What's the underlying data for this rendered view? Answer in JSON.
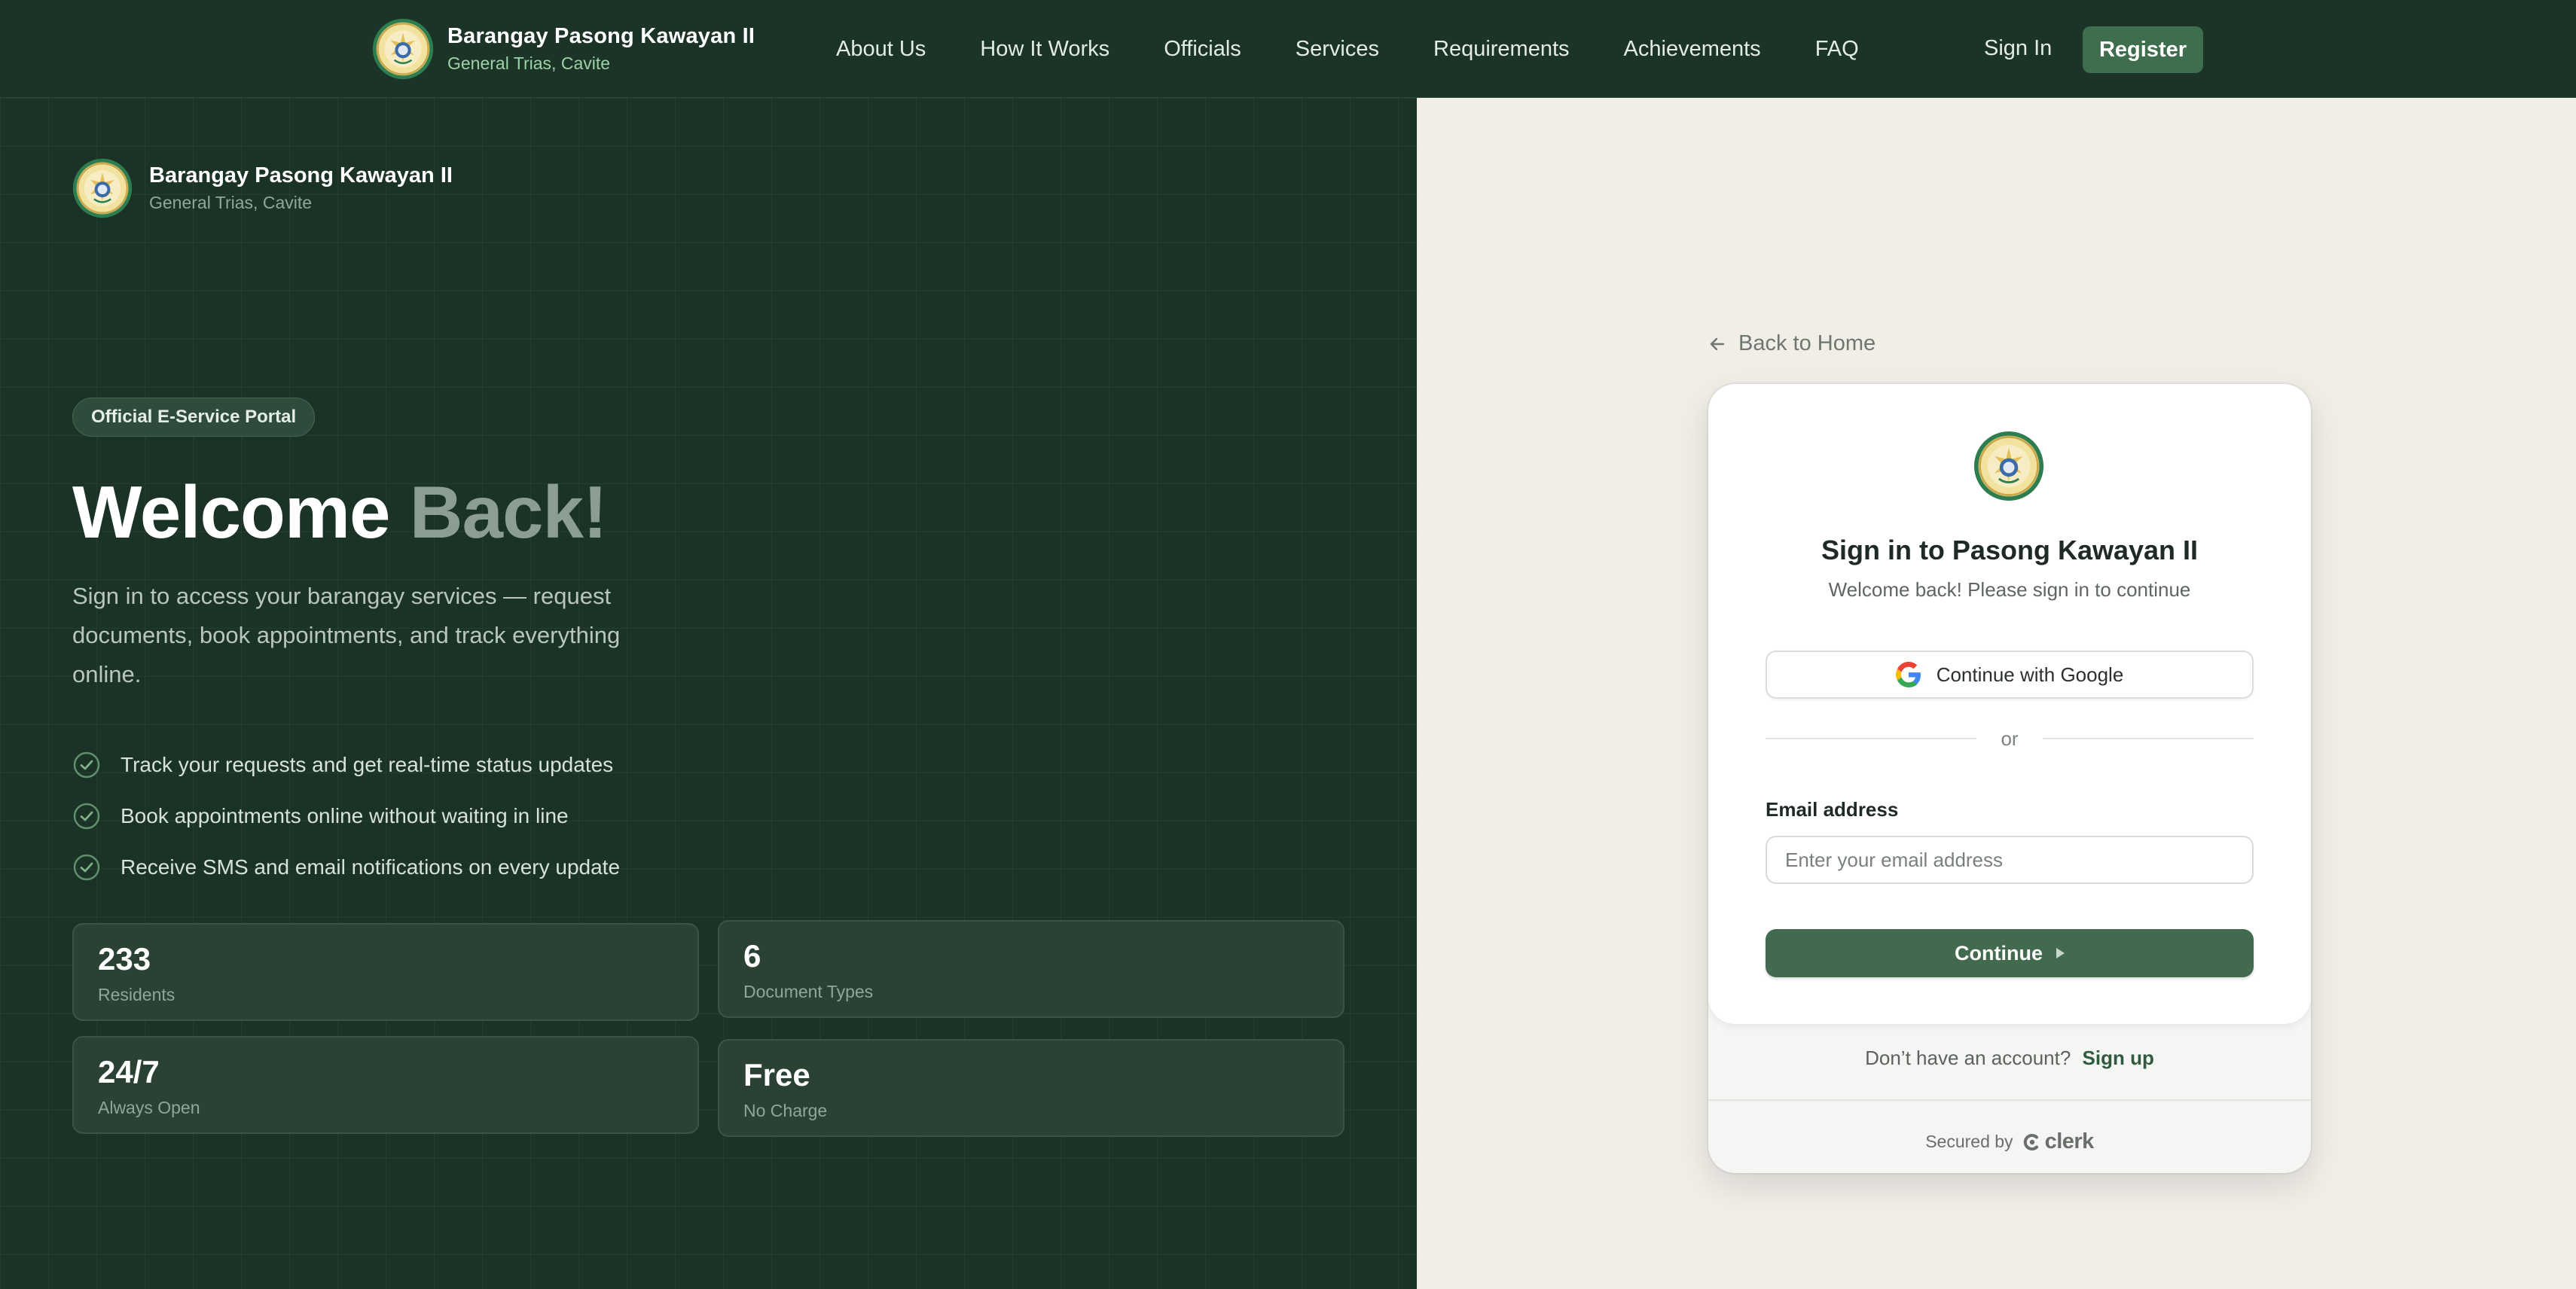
{
  "nav": {
    "brand_name": "Barangay Pasong Kawayan II",
    "brand_location": "General Trias, Cavite",
    "links": [
      "About Us",
      "How It Works",
      "Officials",
      "Services",
      "Requirements",
      "Achievements",
      "FAQ"
    ],
    "sign_in": "Sign In",
    "register": "Register"
  },
  "hero": {
    "brand_name": "Barangay Pasong Kawayan II",
    "brand_location": "General Trias, Cavite",
    "badge": "Official E-Service Portal",
    "title_part1": "Welcome",
    "title_part2": "Back!",
    "description": "Sign in to access your barangay services — request documents, book appointments, and track everything online.",
    "features": [
      "Track your requests and get real-time status updates",
      "Book appointments online without waiting in line",
      "Receive SMS and email notifications on every update"
    ],
    "stats": [
      {
        "value": "233",
        "label": "Residents"
      },
      {
        "value": "6",
        "label": "Document Types"
      },
      {
        "value": "24/7",
        "label": "Always Open"
      },
      {
        "value": "Free",
        "label": "No Charge"
      }
    ]
  },
  "signin": {
    "back_link": "Back to Home",
    "title": "Sign in to Pasong Kawayan II",
    "subtitle": "Welcome back! Please sign in to continue",
    "google_button": "Continue with Google",
    "divider": "or",
    "email_label": "Email address",
    "email_placeholder": "Enter your email address",
    "email_value": "",
    "continue_button": "Continue",
    "no_account_text": "Don’t have an account?",
    "sign_up_link": "Sign up",
    "secured_by": "Secured by",
    "provider": "clerk"
  },
  "colors": {
    "nav_bg": "#1c3428",
    "panel_bg": "#1b3326",
    "accent_green": "#426a4f",
    "right_bg": "#f1eee8"
  },
  "icons": [
    "seal-logo",
    "arrow-left-icon",
    "google-icon",
    "check-circle-icon",
    "caret-right-icon",
    "clerk-logo"
  ]
}
